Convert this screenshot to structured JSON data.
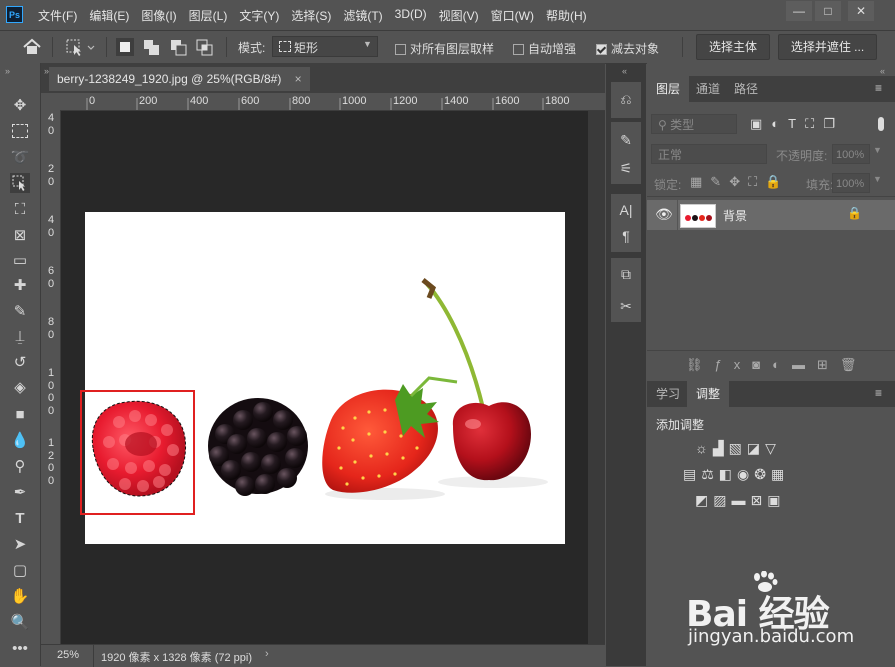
{
  "app": {
    "logo": "Ps"
  },
  "menu": [
    "文件(F)",
    "编辑(E)",
    "图像(I)",
    "图层(L)",
    "文字(Y)",
    "选择(S)",
    "滤镜(T)",
    "3D(D)",
    "视图(V)",
    "窗口(W)",
    "帮助(H)"
  ],
  "window_controls": {
    "minimize": "—",
    "maximize": "□",
    "close": "✕"
  },
  "options": {
    "mode_label": "模式:",
    "mode_value": "矩形",
    "sample_all_layers": {
      "label": "对所有图层取样",
      "checked": false
    },
    "auto_enhance": {
      "label": "自动增强",
      "checked": false
    },
    "subtract_object": {
      "label": "减去对象",
      "checked": true
    },
    "select_subject": "选择主体",
    "select_and_mask": "选择并遮住 ..."
  },
  "document": {
    "tab_title": "berry-1238249_1920.jpg @ 25%(RGB/8#)",
    "ruler_top": [
      "0",
      "200",
      "400",
      "600",
      "800",
      "1000",
      "1200",
      "1400",
      "1600",
      "1800"
    ],
    "ruler_left": [
      "4",
      "0",
      "2",
      "0",
      "4",
      "0",
      "6",
      "0",
      "8",
      "0",
      "1",
      "0",
      "0",
      "0",
      "1",
      "2",
      "0",
      "0"
    ],
    "zoom": "25%",
    "size_info": "1920 像素 x 1328 像素 (72 ppi)"
  },
  "layers_panel": {
    "tabs": [
      "图层",
      "通道",
      "路径"
    ],
    "kind_placeholder": "类型",
    "blend_mode": "正常",
    "opacity_label": "不透明度:",
    "opacity_value": "100%",
    "lock_label": "锁定:",
    "fill_label": "填充:",
    "fill_value": "100%",
    "layers": [
      {
        "name": "背景",
        "visible": true,
        "locked": true
      }
    ]
  },
  "adjustments_panel": {
    "tabs": [
      "学习",
      "调整"
    ],
    "title": "添加调整"
  },
  "watermark": {
    "logo": "Bai 经验",
    "url": "jingyan.baidu.com"
  },
  "colors": {
    "accent": "#31a8ff",
    "selection_rect": "#e02020",
    "panel_bg": "#535353"
  }
}
